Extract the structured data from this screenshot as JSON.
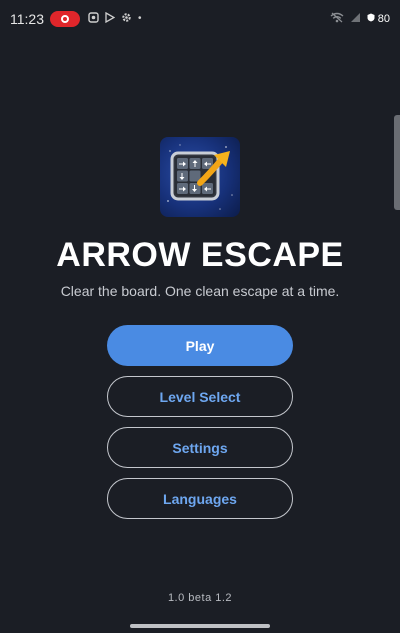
{
  "status_bar": {
    "time": "11:23",
    "battery": "80",
    "dot": "•"
  },
  "app": {
    "title": "ARROW ESCAPE",
    "subtitle": "Clear the board. One clean escape at a time.",
    "version": "1.0 beta 1.2"
  },
  "menu": {
    "play_label": "Play",
    "level_select_label": "Level Select",
    "settings_label": "Settings",
    "languages_label": "Languages"
  },
  "colors": {
    "background": "#1b1e25",
    "primary_button": "#4a8be3",
    "outline_text": "#6ea7f0",
    "record_pill": "#e0262b"
  }
}
